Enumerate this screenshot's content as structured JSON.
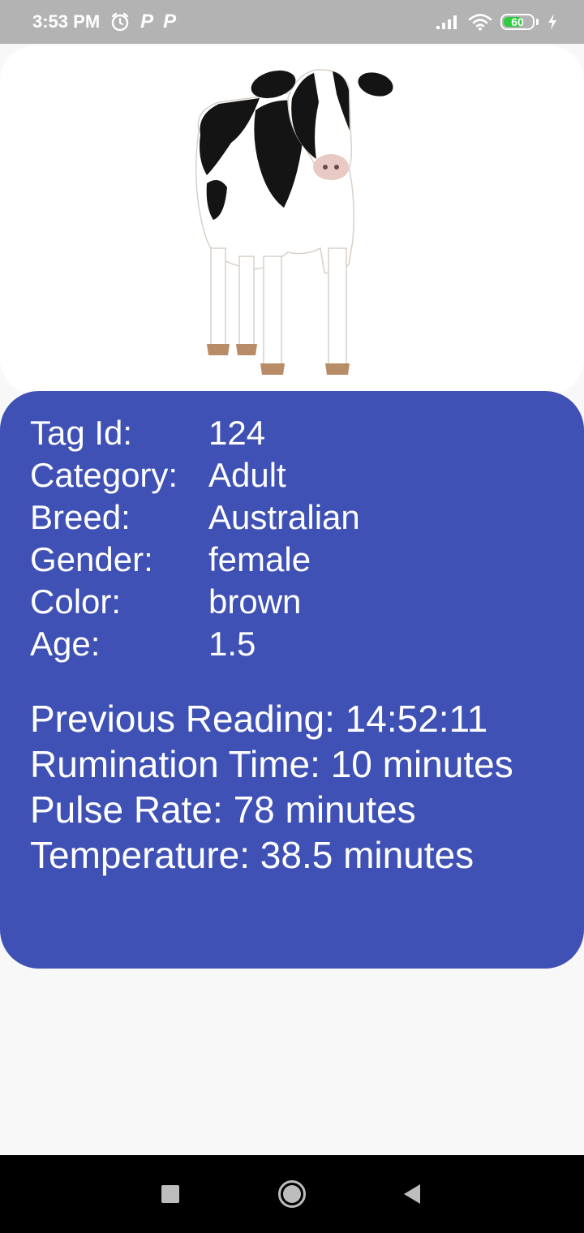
{
  "status_bar": {
    "time": "3:53 PM",
    "left_icons": [
      "alarm-icon",
      "p-app-icon",
      "p-app-icon"
    ],
    "p_glyph": "P",
    "battery_level": "60",
    "right_icons": [
      "signal-icon",
      "wifi-icon",
      "battery-icon",
      "charging-icon"
    ]
  },
  "animal_image": {
    "icon": "cow-photo"
  },
  "details": [
    {
      "label": "Tag Id:",
      "value": "124"
    },
    {
      "label": "Category:",
      "value": "Adult"
    },
    {
      "label": "Breed:",
      "value": "Australian"
    },
    {
      "label": "Gender:",
      "value": "female"
    },
    {
      "label": "Color:",
      "value": "brown"
    },
    {
      "label": "Age:",
      "value": "1.5"
    }
  ],
  "readings": [
    "Previous Reading: 14:52:11",
    "Rumination Time: 10 minutes",
    "Pulse Rate: 78 minutes",
    "Temperature: 38.5 minutes"
  ],
  "colors": {
    "card_background": "#3f51b5",
    "status_bar": "#b3b3b3",
    "battery_fill": "#2ecc40"
  },
  "nav_bar": {
    "buttons": [
      "recents-square-icon",
      "home-circle-icon",
      "back-triangle-icon"
    ]
  }
}
